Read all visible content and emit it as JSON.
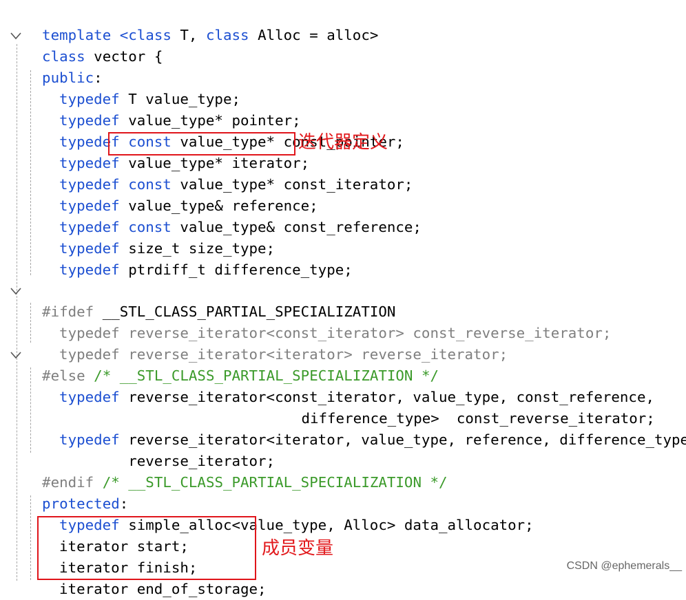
{
  "code": {
    "l01": {
      "kw1": "template ",
      "kw2": "<class",
      "t1": " T, ",
      "kw3": "class",
      "t2": " Alloc = alloc>"
    },
    "l02": {
      "kw": "class",
      "t": " vector {"
    },
    "l03": {
      "kw": "public",
      "t": ":"
    },
    "l04": {
      "kw": "typedef",
      "t": " T value_type;"
    },
    "l05": {
      "kw": "typedef",
      "t": " value_type* pointer;"
    },
    "l06": {
      "kw": "typedef",
      "kw2": " const",
      "t": " value_type* const_pointer;"
    },
    "l07": {
      "kw": "typedef",
      "t": " value_type* iterator;"
    },
    "l08": {
      "kw": "typedef",
      "kw2": " const",
      "t": " value_type* const_iterator;"
    },
    "l09": {
      "kw": "typedef",
      "t": " value_type& reference;"
    },
    "l10": {
      "kw": "typedef",
      "kw2": " const",
      "t": " value_type& const_reference;"
    },
    "l11": {
      "kw": "typedef",
      "t": " size_t size_type;"
    },
    "l12": {
      "kw": "typedef",
      "t": " ptrdiff_t difference_type;"
    },
    "l14": {
      "pp": "#ifdef",
      "t": " __STL_CLASS_PARTIAL_SPECIALIZATION"
    },
    "l15": {
      "kw": "typedef",
      "t": " reverse_iterator<const_iterator> const_reverse_iterator;"
    },
    "l16": {
      "kw": "typedef",
      "t": " reverse_iterator<iterator> reverse_iterator;"
    },
    "l17": {
      "pp": "#else",
      "cm": " /* __STL_CLASS_PARTIAL_SPECIALIZATION */"
    },
    "l18": {
      "kw": "typedef",
      "t": " reverse_iterator<const_iterator, value_type, const_reference,"
    },
    "l19": {
      "t": "                    difference_type>  const_reverse_iterator;"
    },
    "l20": {
      "kw": "typedef",
      "t": " reverse_iterator<iterator, value_type, reference, difference_type>"
    },
    "l21": {
      "t": "        reverse_iterator;"
    },
    "l22": {
      "pp": "#endif",
      "cm": " /* __STL_CLASS_PARTIAL_SPECIALIZATION */"
    },
    "l23": {
      "kw": "protected",
      "t": ":"
    },
    "l24": {
      "kw": "typedef",
      "t": " simple_alloc<value_type, Alloc> data_allocator;"
    },
    "l25": {
      "t": "iterator start;"
    },
    "l26": {
      "t": "iterator finish;"
    },
    "l27": {
      "t": "iterator end_of_storage;"
    }
  },
  "annotations": {
    "iterator_def": "迭代器定义",
    "members": "成员变量"
  },
  "watermark": "CSDN @ephemerals__",
  "colors": {
    "keyword": "#1c4fd1",
    "comment": "#3b9a2a",
    "inactive": "#7f7f7f",
    "highlight_box": "#e0141a",
    "annotation_text": "#e21a1d"
  },
  "icons": [
    "fold-chevron-icon"
  ]
}
